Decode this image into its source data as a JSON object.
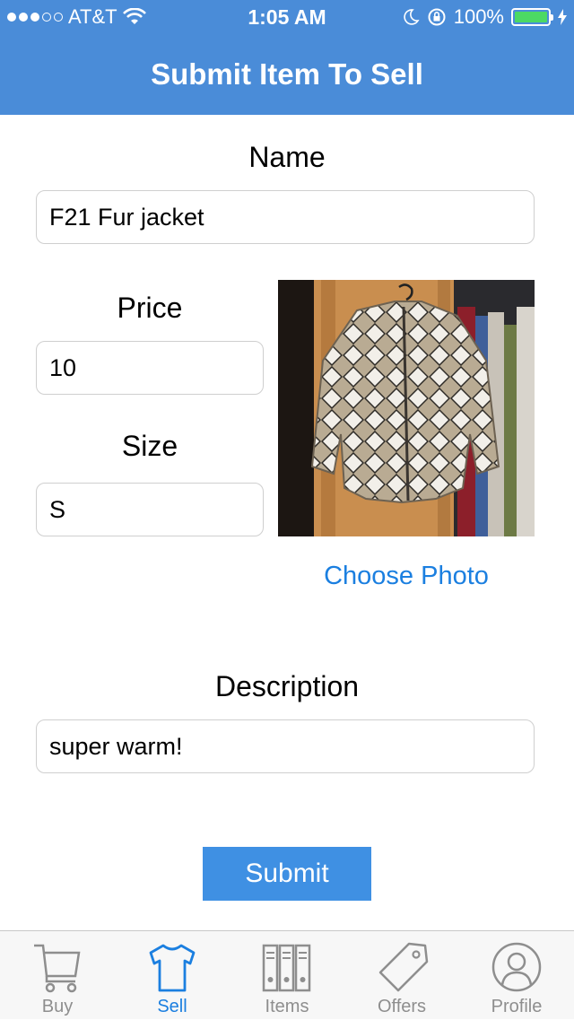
{
  "status_bar": {
    "carrier": "AT&T",
    "time": "1:05 AM",
    "battery_text": "100%",
    "signal_bars_full": 3,
    "signal_bars_total": 5
  },
  "nav": {
    "title": "Submit Item To Sell"
  },
  "form": {
    "name_label": "Name",
    "name_value": "F21 Fur jacket",
    "price_label": "Price",
    "price_value": "10",
    "size_label": "Size",
    "size_value": "S",
    "choose_photo_label": "Choose Photo",
    "description_label": "Description",
    "description_value": "super warm!",
    "submit_label": "Submit"
  },
  "tabbar": {
    "items": [
      {
        "label": "Buy",
        "icon": "cart-icon"
      },
      {
        "label": "Sell",
        "icon": "tshirt-icon"
      },
      {
        "label": "Items",
        "icon": "binders-icon"
      },
      {
        "label": "Offers",
        "icon": "tag-icon"
      },
      {
        "label": "Profile",
        "icon": "profile-icon"
      }
    ],
    "active_index": 1
  },
  "colors": {
    "nav_bar": "#4a8cd8",
    "accent": "#1b7fe0",
    "submit_button": "#3f90e3",
    "battery_fill": "#4cd964",
    "tab_inactive": "#8e8e8e"
  }
}
